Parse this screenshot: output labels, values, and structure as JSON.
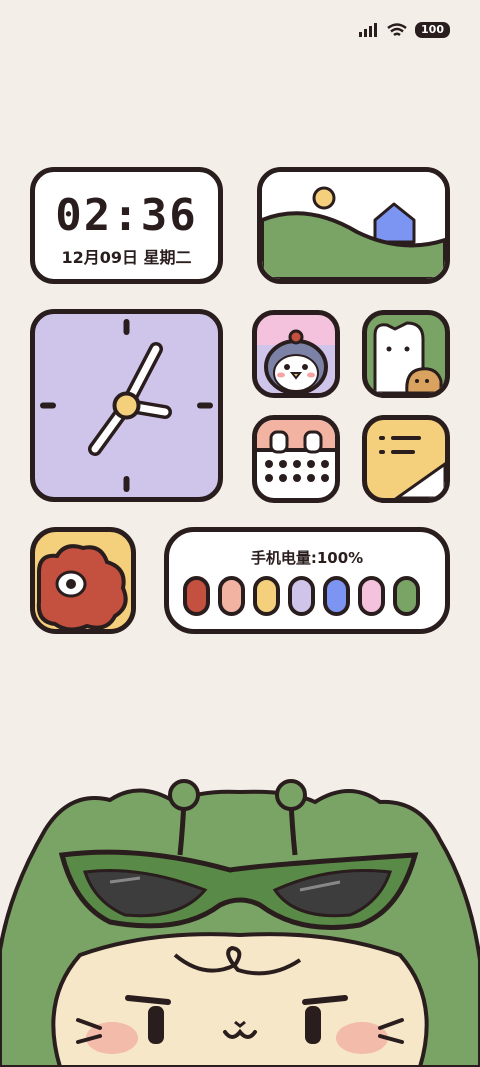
{
  "status_bar": {
    "battery_level": "100",
    "icons": [
      "signal-icon",
      "wifi-icon",
      "battery-icon"
    ]
  },
  "clock_widget": {
    "time": "02:36",
    "date": "12月09日 星期二"
  },
  "battery_widget": {
    "title": "手机电量:100%",
    "pill_colors": [
      "#c4503f",
      "#f2b3a3",
      "#f4cf7c",
      "#cfc4ea",
      "#7c94f2",
      "#f5c2dd",
      "#7aa466"
    ]
  },
  "colors": {
    "background": "#f3efe8",
    "outline": "#2a1d1d",
    "green": "#7aa466",
    "lavender": "#cfc4ea"
  },
  "apps": [
    "penguin-app-icon",
    "cat-app-icon",
    "calendar-app-icon",
    "notes-app-icon",
    "dog-app-icon"
  ]
}
